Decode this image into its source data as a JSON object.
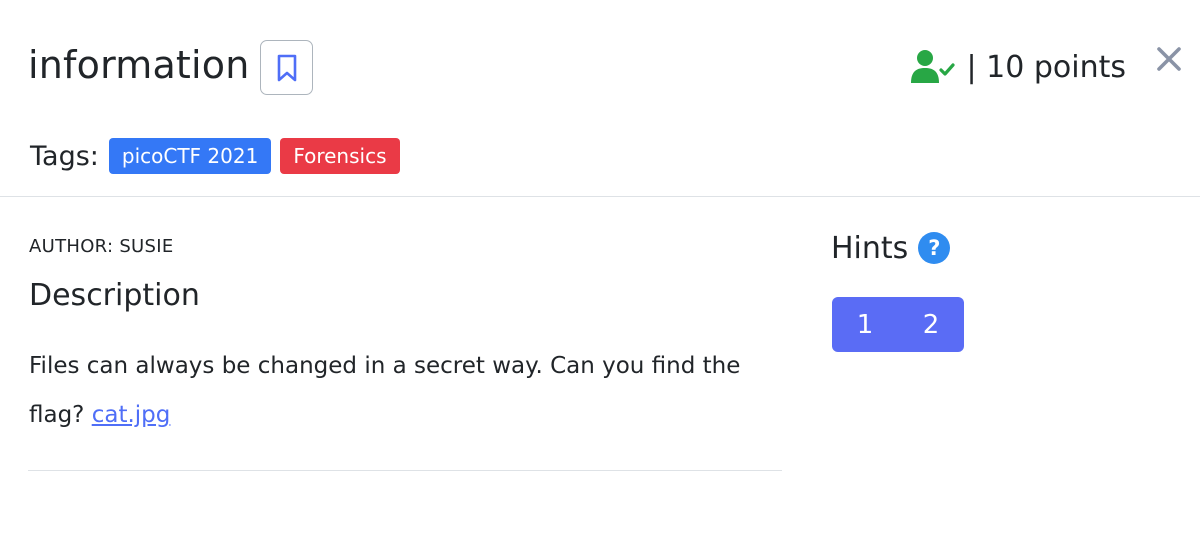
{
  "challenge": {
    "title": "information",
    "points_text": "| 10 points",
    "tags_label": "Tags:",
    "tags": [
      {
        "label": "picoCTF 2021",
        "color": "#3478f6"
      },
      {
        "label": "Forensics",
        "color": "#ea3a46"
      }
    ],
    "author": "AUTHOR: SUSIE",
    "description_heading": "Description",
    "description_text": "Files can always be changed in a secret way. Can you find the flag? ",
    "attachment_link": "cat.jpg"
  },
  "hints": {
    "title": "Hints",
    "help_glyph": "?",
    "buttons": [
      "1",
      "2"
    ]
  },
  "colors": {
    "solved_green": "#28a745",
    "accent_blue": "#4f6ef7",
    "hint_button_bg": "#5a6cf5",
    "help_icon_bg": "#2f8cf0",
    "close_gray": "#8a93a6"
  },
  "icons": {
    "bookmark": "bookmark-icon",
    "solved": "user-check-icon",
    "close": "close-icon",
    "help": "question-circle-icon"
  }
}
